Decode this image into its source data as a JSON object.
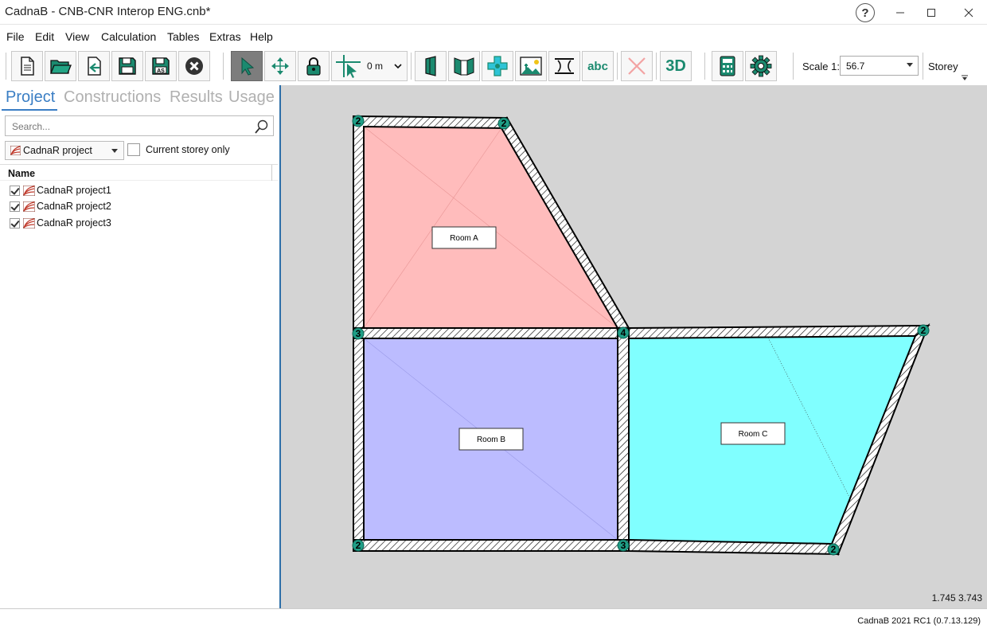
{
  "window": {
    "title": "CadnaB - CNB-CNR Interop ENG.cnb*",
    "help": "?"
  },
  "menu": [
    "File",
    "Edit",
    "View",
    "Calculation",
    "Tables",
    "Extras",
    "Help"
  ],
  "toolbar": {
    "grid_value": "0 m",
    "abc_label": "abc",
    "three_d_label": "3D",
    "scale_label": "Scale 1:",
    "scale_value": "56.7",
    "storey_label": "Storey"
  },
  "panel": {
    "tabs": [
      "Project",
      "Constructions",
      "Results",
      "Usage"
    ],
    "active_tab": "Project",
    "search_placeholder": "Search...",
    "filter_value": "CadnaR project",
    "current_storey_label": "Current storey only",
    "column_header": "Name",
    "items": [
      {
        "label": "CadnaR project1",
        "checked": true
      },
      {
        "label": "CadnaR project2",
        "checked": true
      },
      {
        "label": "CadnaR project3",
        "checked": true
      }
    ]
  },
  "canvas": {
    "rooms": [
      {
        "label": "Room A",
        "fill": "#ffbcbc"
      },
      {
        "label": "Room B",
        "fill": "#bcbcff"
      },
      {
        "label": "Room C",
        "fill": "#80ffff"
      }
    ],
    "node_labels": [
      "2",
      "2",
      "3",
      "4",
      "2",
      "2",
      "3",
      "2"
    ],
    "node_color": "#1f9e86",
    "coordinates": "1.745 3.743"
  },
  "status": {
    "version": "CadnaB 2021 RC1 (0.7.13.129)"
  }
}
